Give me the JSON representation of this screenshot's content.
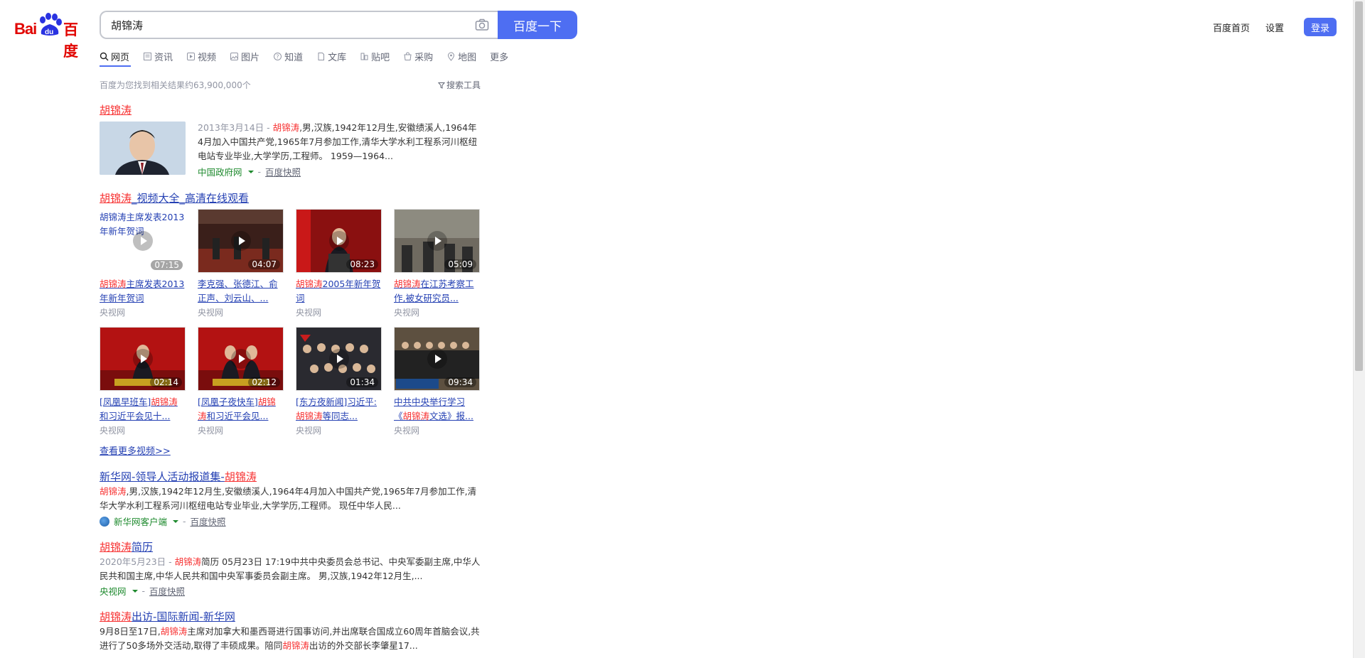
{
  "header": {
    "logo_text": "Bai",
    "logo_du": "du",
    "logo_cn": "百度",
    "search_value": "胡锦涛",
    "search_button": "百度一下",
    "home_link": "百度首页",
    "settings_link": "设置",
    "login_button": "登录"
  },
  "tabs": [
    {
      "label": "网页",
      "icon": "search-icon"
    },
    {
      "label": "资讯",
      "icon": "news-icon"
    },
    {
      "label": "视频",
      "icon": "video-icon"
    },
    {
      "label": "图片",
      "icon": "image-icon"
    },
    {
      "label": "知道",
      "icon": "question-icon"
    },
    {
      "label": "文库",
      "icon": "document-icon"
    },
    {
      "label": "贴吧",
      "icon": "tieba-icon"
    },
    {
      "label": "采购",
      "icon": "shop-icon"
    },
    {
      "label": "地图",
      "icon": "map-icon"
    },
    {
      "label": "更多",
      "icon": ""
    }
  ],
  "stats": "百度为您找到相关结果约63,900,000个",
  "search_tools": "搜索工具",
  "result1": {
    "title": "胡锦涛",
    "date": "2013年3月14日 - ",
    "name": "胡锦涛",
    "abstract": ",男,汉族,1942年12月生,安徽绩溪人,1964年4月加入中国共产党,1965年7月参加工作,清华大学水利工程系河川枢纽电站专业毕业,大学学历,工程师。 1959—1964...",
    "source": "中国政府网",
    "snapshot": "百度快照"
  },
  "video_section": {
    "title_em": "胡锦涛",
    "title_rest": "_视频大全_高清在线观看",
    "more": "查看更多视频>>",
    "videos": [
      {
        "alt": "胡锦涛主席发表2013年新年贺词",
        "duration": "07:15",
        "title_em": "胡锦涛",
        "title_rest": "主席发表2013年新年贺词",
        "source": "央视网",
        "pre": ""
      },
      {
        "duration": "04:07",
        "title_em": "",
        "title_rest": "李克强、张德江、俞正声、刘云山、...",
        "source": "央视网",
        "pre": ""
      },
      {
        "duration": "08:23",
        "title_em": "胡锦涛",
        "title_rest": "2005年新年贺词",
        "source": "央视网",
        "pre": ""
      },
      {
        "duration": "05:09",
        "title_em": "胡锦涛",
        "title_rest": "在江苏考察工作,被女研究员...",
        "source": "央视网",
        "pre": ""
      },
      {
        "duration": "02:14",
        "pre": "[凤凰早班车]",
        "title_em": "胡锦涛",
        "title_rest": "和习近平会见十...",
        "source": "央视网"
      },
      {
        "duration": "02:12",
        "pre": "[凤凰子夜快车]",
        "title_em": "胡锦涛",
        "title_rest": "和习近平会见...",
        "source": "央视网"
      },
      {
        "duration": "01:34",
        "pre": "[东方夜新闻]习近平:",
        "title_em": "胡锦涛",
        "title_rest": "等同志...",
        "source": "央视网"
      },
      {
        "duration": "09:34",
        "pre": "中共中央举行学习《",
        "title_em": "胡锦涛",
        "title_rest": "文选》报...",
        "source": "央视网"
      }
    ]
  },
  "result3": {
    "title_pre": "新华网-领导人活动报道集-",
    "title_em": "胡锦涛",
    "name": "胡锦涛",
    "abstract": ",男,汉族,1942年12月生,安徽绩溪人,1964年4月加入中国共产党,1965年7月参加工作,清华大学水利工程系河川枢纽电站专业毕业,大学学历,工程师。 现任中华人民...",
    "source": "新华网客户端",
    "snapshot": "百度快照"
  },
  "result4": {
    "title_em": "胡锦涛",
    "title_rest": "简历",
    "date": "2020年5月23日 - ",
    "name": "胡锦涛",
    "abstract": "简历 05月23日 17:19中共中央委员会总书记、中央军委副主席,中华人民共和国主席,中华人民共和国中央军事委员会副主席。 男,汉族,1942年12月生,...",
    "source": "央视网",
    "snapshot": "百度快照"
  },
  "result5": {
    "title_em": "胡锦涛",
    "title_rest": "出访-国际新闻-新华网",
    "abstract_a": "9月8日至17日,",
    "name": "胡锦涛",
    "abstract_b": "主席对加拿大和墨西哥进行国事访问,并出席联合国成立60周年首脑会议,共进行了50多场外交活动,取得了丰硕成果。陪同",
    "abstract_c": "出访的外交部长李肇星17..."
  },
  "colors": {
    "accent": "#4e6ef2",
    "link": "#2440b3",
    "highlight": "#f73131",
    "source_green": "#1e8a2e"
  }
}
